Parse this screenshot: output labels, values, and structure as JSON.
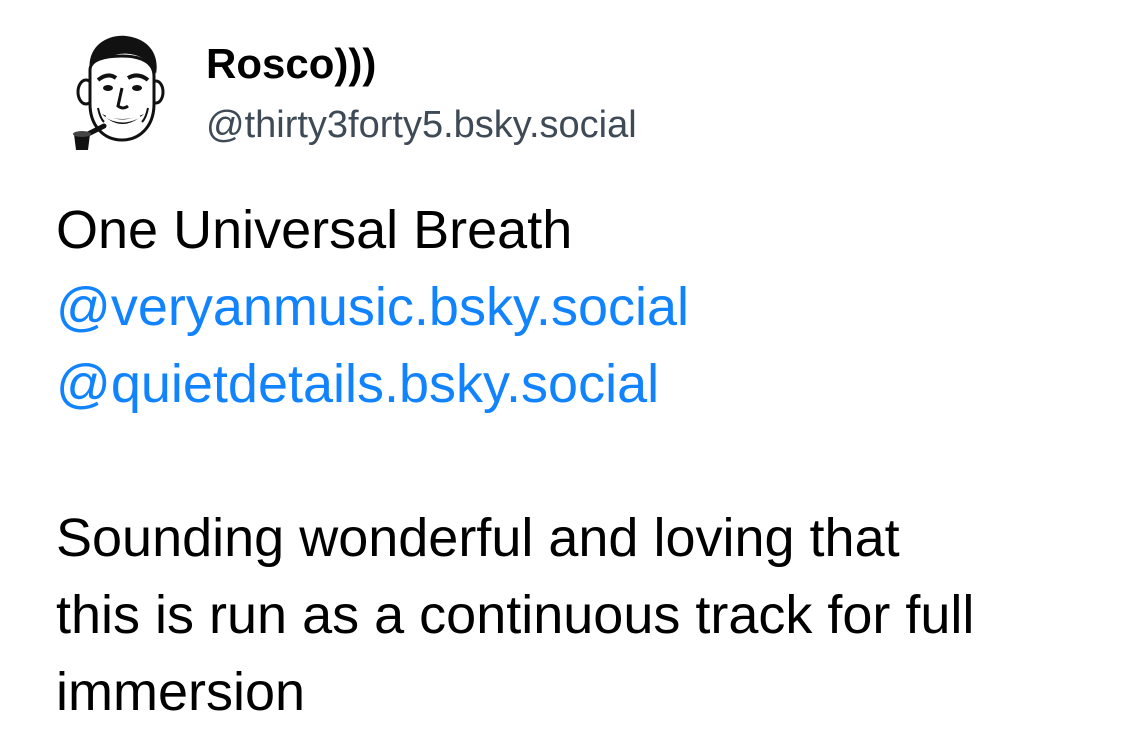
{
  "author": {
    "display_name": "Rosco)))",
    "handle": "@thirty3forty5.bsky.social",
    "avatar_icon": "retro-man-with-pipe-avatar-icon"
  },
  "post": {
    "title_line": "One Universal Breath",
    "mentions": [
      "@veryanmusic.bsky.social",
      "@quietdetails.bsky.social"
    ],
    "text_lines": [
      "Sounding wonderful and loving that",
      "this is run as a continuous track for full",
      "immersion"
    ]
  },
  "colors": {
    "text": "#000000",
    "handle": "#3f4a57",
    "link": "#1183fe",
    "background": "#ffffff"
  }
}
